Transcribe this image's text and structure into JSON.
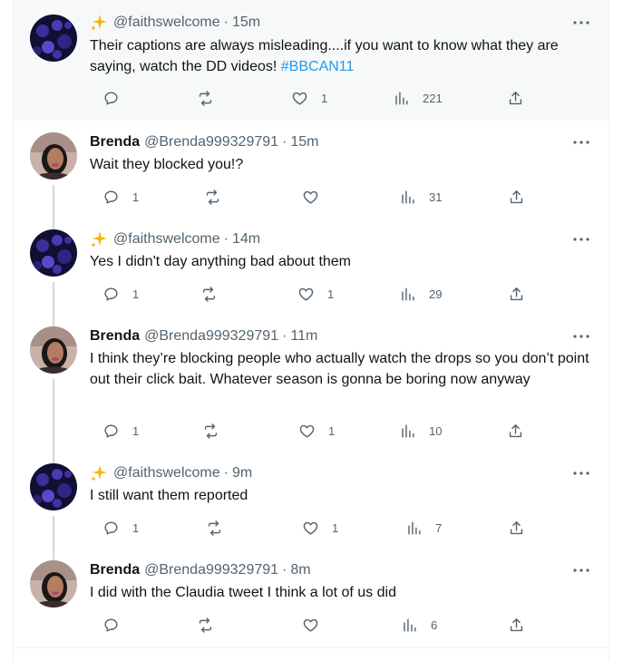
{
  "tweets": [
    {
      "display_name": "",
      "handle": "@faithswelcome",
      "time": "15m",
      "text": "Their captions are always misleading....if you want to know what they are saying, watch the DD videos! ",
      "hashtag": "#BBCAN11",
      "replies": "",
      "likes": "1",
      "views": "221",
      "sparkle": true
    },
    {
      "display_name": "Brenda",
      "handle": "@Brenda999329791",
      "time": "15m",
      "text": "Wait they blocked you!?",
      "hashtag": "",
      "replies": "1",
      "likes": "",
      "views": "31",
      "sparkle": false
    },
    {
      "display_name": "",
      "handle": "@faithswelcome",
      "time": "14m",
      "text": "Yes I didn't day anything bad about them",
      "hashtag": "",
      "replies": "1",
      "likes": "1",
      "views": "29",
      "sparkle": true
    },
    {
      "display_name": "Brenda",
      "handle": "@Brenda999329791",
      "time": "11m",
      "text": "I think they’re blocking people who actually watch the drops so you don’t point out their click bait. Whatever season is gonna be boring now anyway",
      "hashtag": "",
      "replies": "1",
      "likes": "1",
      "views": "10",
      "sparkle": false
    },
    {
      "display_name": "",
      "handle": "@faithswelcome",
      "time": "9m",
      "text": "I still want them reported",
      "hashtag": "",
      "replies": "1",
      "likes": "1",
      "views": "7",
      "sparkle": true
    },
    {
      "display_name": "Brenda",
      "handle": "@Brenda999329791",
      "time": "8m",
      "text": "I did with the Claudia tweet I think a lot of us did",
      "hashtag": "",
      "replies": "",
      "likes": "",
      "views": "6",
      "sparkle": false
    }
  ],
  "separator": "·",
  "colors": {
    "text": "#0f1419",
    "secondary": "#536471",
    "link": "#1d9bf0",
    "thread_line": "#cfd9de",
    "highlight_bg": "#f7f9f9"
  }
}
